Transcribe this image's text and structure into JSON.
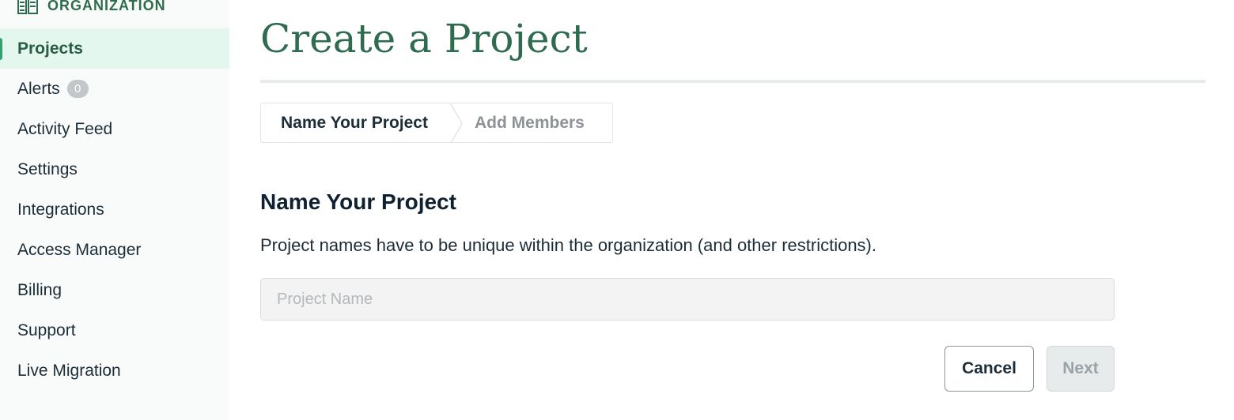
{
  "sidebar": {
    "org_label": "ORGANIZATION",
    "org_icon": "building-icon",
    "items": [
      {
        "label": "Projects",
        "active": true
      },
      {
        "label": "Alerts",
        "badge": "0"
      },
      {
        "label": "Activity Feed"
      },
      {
        "label": "Settings"
      },
      {
        "label": "Integrations"
      },
      {
        "label": "Access Manager"
      },
      {
        "label": "Billing"
      },
      {
        "label": "Support"
      },
      {
        "label": "Live Migration"
      }
    ]
  },
  "main": {
    "title": "Create a Project",
    "steps": [
      {
        "label": "Name Your Project",
        "active": true
      },
      {
        "label": "Add Members",
        "active": false
      }
    ],
    "section_title": "Name Your Project",
    "section_desc": "Project names have to be unique within the organization (and other restrictions).",
    "project_name": {
      "value": "",
      "placeholder": "Project Name"
    },
    "buttons": {
      "cancel": "Cancel",
      "next": "Next"
    }
  },
  "colors": {
    "accent": "#2f6b4f",
    "active_bg": "#e3f7ef",
    "active_indicator": "#35a06b",
    "badge_bg": "#c3c7c9"
  }
}
